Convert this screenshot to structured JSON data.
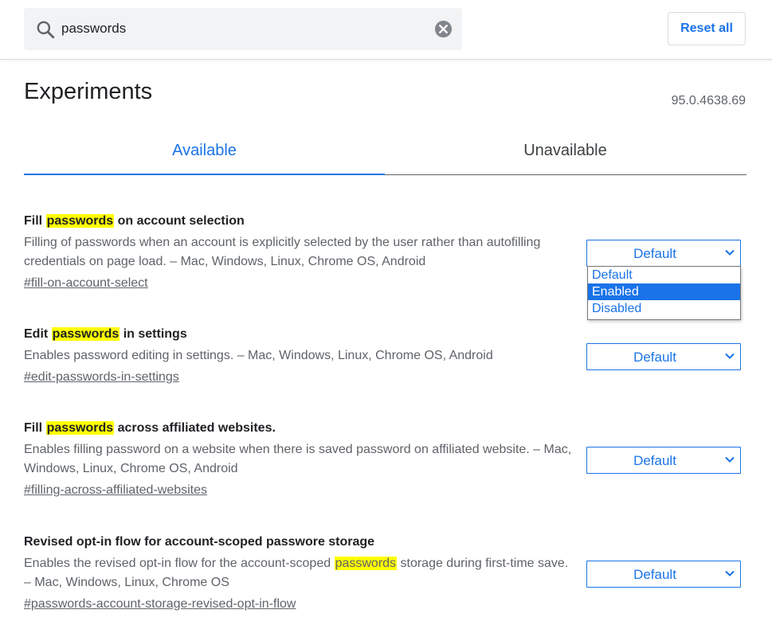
{
  "search": {
    "value": "passwords"
  },
  "header": {
    "reset_label": "Reset all"
  },
  "page": {
    "title": "Experiments",
    "version": "95.0.4638.69"
  },
  "tabs": [
    {
      "label": "Available",
      "active": true
    },
    {
      "label": "Unavailable",
      "active": false
    }
  ],
  "experiments": [
    {
      "title_pre": "Fill ",
      "title_hl": "passwords",
      "title_post": " on account selection",
      "desc": "Filling of passwords when an account is explicitly selected by the user rather than autofilling credentials on page load. – Mac, Windows, Linux, Chrome OS, Android",
      "link": "#fill-on-account-select",
      "value": "Default"
    },
    {
      "title_pre": "Edit ",
      "title_hl": "passwords",
      "title_post": " in settings",
      "desc": "Enables password editing in settings. – Mac, Windows, Linux, Chrome OS, Android",
      "link": "#edit-passwords-in-settings",
      "value": "Default"
    },
    {
      "title_pre": "Fill ",
      "title_hl": "passwords",
      "title_post": " across affiliated websites.",
      "desc": "Enables filling password on a website when there is saved password on affiliated website. – Mac, Windows, Linux, Chrome OS, Android",
      "link": "#filling-across-affiliated-websites",
      "value": "Default"
    },
    {
      "title": "Revised opt-in flow for account-scoped passwore storage",
      "desc_pre": "Enables the revised opt-in flow for the account-scoped ",
      "desc_hl": "passwords",
      "desc_post": " storage during first-time save. – Mac, Windows, Linux, Chrome OS",
      "link": "#passwords-account-storage-revised-opt-in-flow",
      "value": "Default"
    }
  ],
  "dropdown": {
    "options": [
      "Default",
      "Enabled",
      "Disabled"
    ],
    "highlighted": "Enabled"
  },
  "colors": {
    "accent": "#1a73e8",
    "highlight": "#ffff00",
    "text_secondary": "#5f6368"
  },
  "icons": {
    "search": "search-icon",
    "clear": "clear-icon",
    "chevron": "chevron-down-icon"
  }
}
